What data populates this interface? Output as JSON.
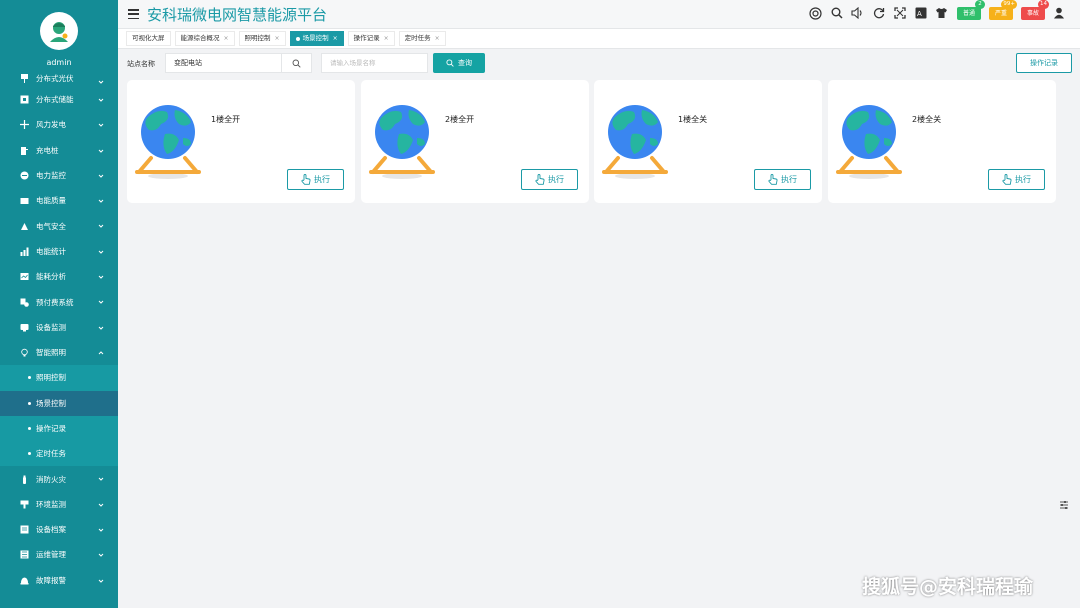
{
  "app": {
    "title": "安科瑞微电网智慧能源平台"
  },
  "user": {
    "name": "admin"
  },
  "sidebar": {
    "partial_item": {
      "label": "分布式光伏"
    },
    "items": [
      {
        "label": "分布式储能",
        "icon": "storage-icon"
      },
      {
        "label": "风力发电",
        "icon": "wind-turbine-icon"
      },
      {
        "label": "充电桩",
        "icon": "charging-pile-icon"
      },
      {
        "label": "电力监控",
        "icon": "power-monitor-icon"
      },
      {
        "label": "电能质量",
        "icon": "power-quality-icon"
      },
      {
        "label": "电气安全",
        "icon": "electrical-safety-icon"
      },
      {
        "label": "电能统计",
        "icon": "bar-chart-icon"
      },
      {
        "label": "能耗分析",
        "icon": "energy-analysis-icon"
      },
      {
        "label": "预付费系统",
        "icon": "prepaid-icon"
      },
      {
        "label": "设备监测",
        "icon": "device-monitor-icon"
      },
      {
        "label": "智能照明",
        "icon": "lightbulb-icon"
      }
    ],
    "submenu": [
      {
        "label": "照明控制"
      },
      {
        "label": "场景控制"
      },
      {
        "label": "操作记录"
      },
      {
        "label": "定时任务"
      }
    ],
    "items_after": [
      {
        "label": "消防火灾",
        "icon": "fire-extinguisher-icon"
      },
      {
        "label": "环境监测",
        "icon": "environment-icon"
      },
      {
        "label": "设备档案",
        "icon": "archive-icon"
      },
      {
        "label": "运维管理",
        "icon": "maintenance-icon"
      },
      {
        "label": "故障报警",
        "icon": "alarm-icon"
      }
    ]
  },
  "header": {
    "status": [
      {
        "label": "普通",
        "badge": "2",
        "color": "#2fbf6b"
      },
      {
        "label": "严重",
        "badge": "99+",
        "color": "#f6b11a"
      },
      {
        "label": "事故",
        "badge": "14",
        "color": "#ee4b4b"
      }
    ]
  },
  "tabs": [
    {
      "label": "可视化大屏"
    },
    {
      "label": "能源综合概况"
    },
    {
      "label": "照明控制"
    },
    {
      "label": "场景控制"
    },
    {
      "label": "操作记录"
    },
    {
      "label": "定时任务"
    }
  ],
  "search": {
    "station_label": "站点名称",
    "station_value": "变配电站",
    "scene_placeholder": "请输入场景名称",
    "query_label": "查询",
    "log_label": "操作记录"
  },
  "scenes": [
    {
      "name": "1楼全开",
      "button": "执行"
    },
    {
      "name": "2楼全开",
      "button": "执行"
    },
    {
      "name": "1楼全关",
      "button": "执行"
    },
    {
      "name": "2楼全关",
      "button": "执行"
    }
  ],
  "watermark": "搜狐号@安科瑞程瑜",
  "colors": {
    "primary": "#1b9aa6",
    "sidebar": "#148c96",
    "active_sub": "#1f6f8b"
  }
}
